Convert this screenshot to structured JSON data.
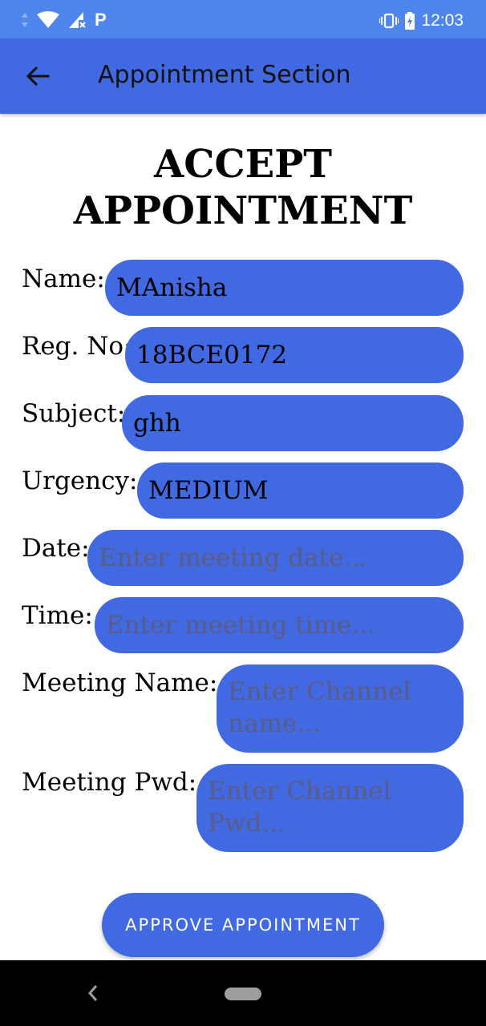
{
  "status_bar": {
    "carrier_letter": "P",
    "time": "12:03",
    "icons": [
      "data-arrows-icon",
      "wifi-icon",
      "signal-icon",
      "parking-app-icon",
      "vibrate-icon",
      "battery-icon"
    ]
  },
  "app_bar": {
    "title": "Appointment Section",
    "back_icon": "arrow-left-icon"
  },
  "heading": "ACCEPT\nAPPOINTMENT",
  "form": {
    "name": {
      "label": "Name:",
      "value": "MAnisha"
    },
    "reg": {
      "label": "Reg. No:",
      "value": "18BCE0172"
    },
    "subject": {
      "label": "Subject:",
      "value": "ghh"
    },
    "urgency": {
      "label": "Urgency:",
      "value": "MEDIUM"
    },
    "date": {
      "label": "Date:",
      "placeholder": "Enter meeting date..."
    },
    "time": {
      "label": "Time:",
      "placeholder": "Enter meeting time..."
    },
    "meeting_name": {
      "label": "Meeting Name:",
      "placeholder": "Enter Channel name..."
    },
    "meeting_pwd": {
      "label": "Meeting Pwd:",
      "placeholder": "Enter Channel Pwd..."
    }
  },
  "approve_button": "APPROVE APPOINTMENT",
  "colors": {
    "status_bar": "#4f86ee",
    "app_bar": "#4169e1",
    "field": "#4169e1",
    "button": "#4169e1",
    "nav_bar": "#000000"
  }
}
